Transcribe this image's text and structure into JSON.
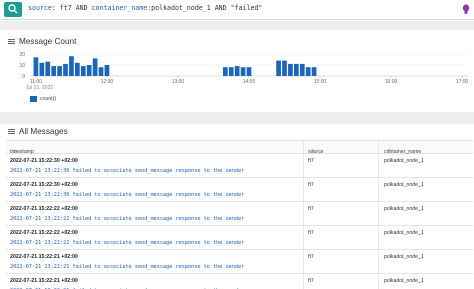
{
  "query": {
    "source_field": "source",
    "source_value": "ft7",
    "and1": "AND",
    "container_field": "container_name",
    "container_value": "polkadot_node_1",
    "and2": "AND",
    "term": "\"failed\""
  },
  "message_count": {
    "title": "Message Count",
    "legend": "count()"
  },
  "chart_data": {
    "type": "bar",
    "ylim": [
      0,
      20
    ],
    "y_ticks": [
      "20",
      "10",
      "0"
    ],
    "x_ticks": [
      "11:00",
      "12:00",
      "13:00",
      "14:00",
      "15:00",
      "16:00",
      "17:00"
    ],
    "date_label": "Jul 21, 2022",
    "series": [
      {
        "name": "count()",
        "color": "#1b66b8"
      }
    ],
    "bars": [
      {
        "x": "11:00",
        "value": 17
      },
      {
        "x": "11:05",
        "value": 12
      },
      {
        "x": "11:10",
        "value": 13
      },
      {
        "x": "11:15",
        "value": 9
      },
      {
        "x": "11:20",
        "value": 9
      },
      {
        "x": "11:25",
        "value": 11
      },
      {
        "x": "11:30",
        "value": 18
      },
      {
        "x": "11:35",
        "value": 12
      },
      {
        "x": "11:40",
        "value": 9
      },
      {
        "x": "11:45",
        "value": 10
      },
      {
        "x": "11:50",
        "value": 16
      },
      {
        "x": "11:55",
        "value": 8
      },
      {
        "x": "12:00",
        "value": 10
      },
      {
        "x": "13:40",
        "value": 8
      },
      {
        "x": "13:45",
        "value": 8
      },
      {
        "x": "13:50",
        "value": 9
      },
      {
        "x": "13:55",
        "value": 8
      },
      {
        "x": "14:00",
        "value": 8
      },
      {
        "x": "14:25",
        "value": 14
      },
      {
        "x": "14:30",
        "value": 14
      },
      {
        "x": "14:35",
        "value": 11
      },
      {
        "x": "14:40",
        "value": 11
      },
      {
        "x": "14:45",
        "value": 11
      },
      {
        "x": "14:50",
        "value": 8
      },
      {
        "x": "14:55",
        "value": 8
      }
    ]
  },
  "all_messages": {
    "title": "All Messages",
    "columns": [
      "timestamp",
      "source",
      "container_name"
    ],
    "rows": [
      {
        "timestamp": "2022-07-21 15:22:30 +02:00",
        "message": "2022-07-21 13:22:30 failed to associate send_message response to the sender",
        "source": "ft7",
        "container_name": "polkadot_node_1"
      },
      {
        "timestamp": "2022-07-21 15:22:30 +02:00",
        "message": "2022-07-21 13:22:30 failed to associate send_message response to the sender",
        "source": "ft7",
        "container_name": "polkadot_node_1"
      },
      {
        "timestamp": "2022-07-21 15:22:22 +02:00",
        "message": "2022-07-21 13:22:22 failed to associate send_message response to the sender",
        "source": "ft7",
        "container_name": "polkadot_node_1"
      },
      {
        "timestamp": "2022-07-21 15:22:22 +02:00",
        "message": "2022-07-21 13:22:22 failed to associate send_message response to the sender",
        "source": "ft7",
        "container_name": "polkadot_node_1"
      },
      {
        "timestamp": "2022-07-21 15:22:21 +02:00",
        "message": "2022-07-21 13:22:21 failed to associate send_message response to the sender",
        "source": "ft7",
        "container_name": "polkadot_node_1"
      },
      {
        "timestamp": "2022-07-21 15:22:21 +02:00",
        "message": "2022-07-21 13:22:21 failed to associate send_message response to the sender",
        "source": "ft7",
        "container_name": "polkadot_node_1"
      }
    ]
  }
}
